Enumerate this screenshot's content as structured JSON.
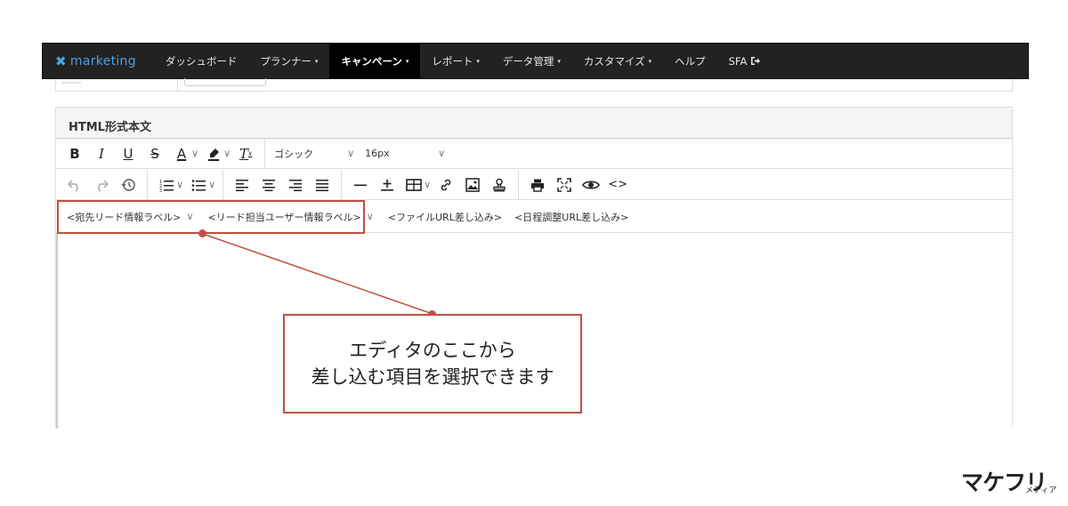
{
  "navbar": {
    "brand": "marketing",
    "items": [
      {
        "label": "ダッシュボード",
        "caret": ""
      },
      {
        "label": "プランナー",
        "caret": "▾"
      },
      {
        "label": "キャンペーン",
        "caret": "▾",
        "active": true
      },
      {
        "label": "レポート",
        "caret": "▾"
      },
      {
        "label": "データ管理",
        "caret": "▾"
      },
      {
        "label": "カスタマイズ",
        "caret": "▾"
      },
      {
        "label": "ヘルプ",
        "caret": ""
      },
      {
        "label": "SFA",
        "caret": ""
      }
    ],
    "colors": {
      "bg": "#222222",
      "active_bg": "#000000",
      "brand": "#4aa3e0"
    }
  },
  "panel": {
    "title": "HTML形式本文"
  },
  "toolbar": {
    "font_family": "ゴシック",
    "font_size": "16px",
    "row1_icons": [
      "bold-icon",
      "italic-icon",
      "underline-icon",
      "strikethrough-icon",
      "font-color-icon",
      "highlight-icon",
      "clear-format-icon"
    ],
    "row2_icons": [
      "undo-icon",
      "redo-icon",
      "history-icon",
      "ordered-list-icon",
      "unordered-list-icon",
      "align-left-icon",
      "align-center-icon",
      "align-right-icon",
      "align-justify-icon",
      "horizontal-rule-icon",
      "insert-icon",
      "table-icon",
      "link-icon",
      "image-icon",
      "stamp-icon",
      "print-icon",
      "fullscreen-icon",
      "preview-icon",
      "code-icon"
    ],
    "labels": {
      "bold": "B",
      "italic": "I",
      "underline": "U",
      "strike": "S",
      "font_color": "A",
      "clear": "T",
      "code": "<>"
    }
  },
  "merge_tags": [
    "<宛先リード情報ラベル>",
    "<リード担当ユーザー情報ラベル>",
    "<ファイルURL差し込み>",
    "<日程調整URL差し込み>"
  ],
  "annotation": {
    "line1": "エディタのここから",
    "line2": "差し込む項目を選択できます",
    "color": "#c0513f"
  },
  "logo": {
    "main": "マケフリ",
    "sub": "メディア"
  }
}
